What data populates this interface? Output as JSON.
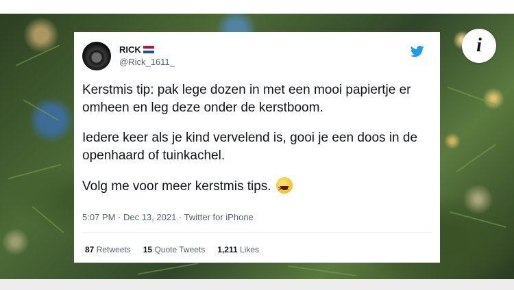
{
  "info_button": {
    "icon": "info-icon",
    "glyph": "i"
  },
  "tweet": {
    "author_name": "RICK",
    "author_flag": {
      "icon": "netherlands-flag-icon",
      "colors": [
        "#c8102e",
        "#ffffff",
        "#1e4ca0"
      ]
    },
    "author_handle": "@Rick_1611_",
    "brand_icon": "twitter-bird-icon",
    "brand_color": "#1d9bf0",
    "body_paragraphs": [
      "Kerstmis tip: pak lege dozen in met een mooi papiertje er omheen en leg deze onder de kerstboom.",
      "Iedere keer als je kind vervelend is, gooi je een doos in de openhaard of tuinkachel.",
      "Volg me voor meer kerstmis tips."
    ],
    "emoji_icon": "grinning-squinting-face-icon",
    "timestamp": "5:07 PM · Dec 13, 2021 · Twitter for iPhone",
    "stats": [
      {
        "count": "87",
        "label": "Retweets"
      },
      {
        "count": "15",
        "label": "Quote Tweets"
      },
      {
        "count": "1,211",
        "label": "Likes"
      }
    ]
  }
}
